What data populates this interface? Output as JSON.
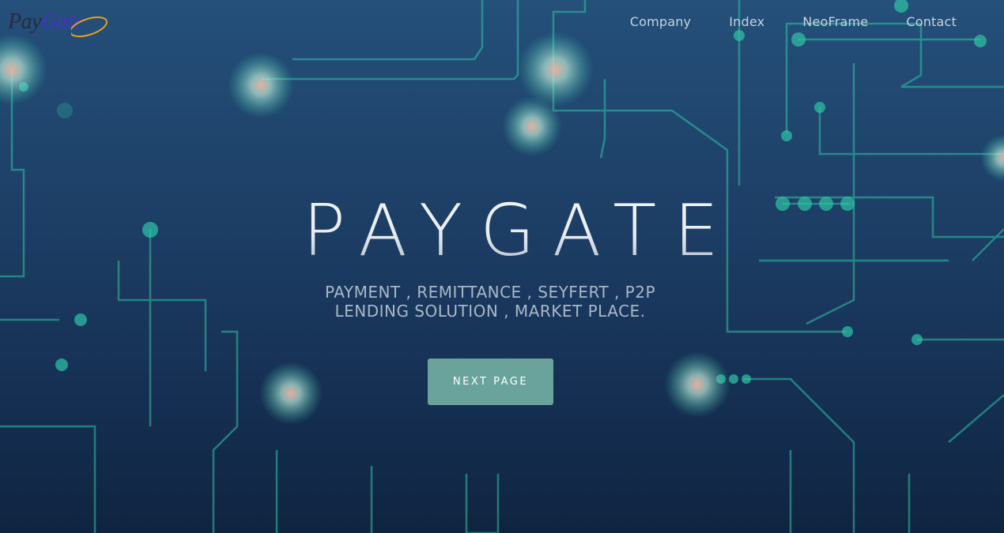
{
  "logo": {
    "pay": "Pay",
    "gate": "Gate"
  },
  "nav": {
    "items": [
      "Company",
      "Index",
      "NeoFrame",
      "Contact"
    ]
  },
  "hero": {
    "title": "PAYGATE",
    "subtitle_line1": "PAYMENT , REMITTANCE , SEYFERT , P2P",
    "subtitle_line2": "LENDING SOLUTION , MARKET PLACE.",
    "button": "NEXT PAGE"
  },
  "colors": {
    "background_top": "#24507a",
    "background_bottom": "#0f2440",
    "circuit": "#2ec4a5",
    "button": "#69a39c"
  }
}
